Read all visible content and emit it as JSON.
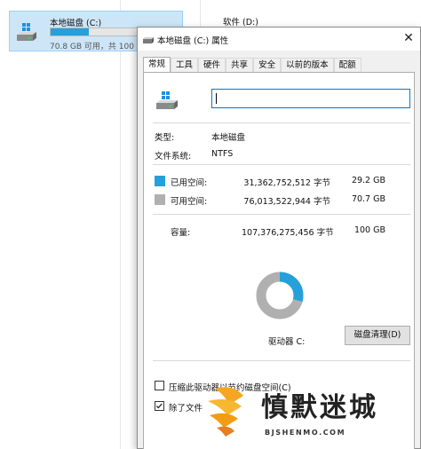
{
  "explorer": {
    "drive_c": {
      "name": "本地磁盘 (C:)",
      "free_text": "70.8 GB 可用，共 100 GB",
      "used_fraction": 0.29
    },
    "drive_d": {
      "name": "软件 (D:)"
    }
  },
  "dialog": {
    "title": "本地磁盘 (C:) 属性",
    "close_glyph": "✕",
    "tabs": [
      "常规",
      "工具",
      "硬件",
      "共享",
      "安全",
      "以前的版本",
      "配额"
    ],
    "active_tab": "常规",
    "label_value": "",
    "type_label": "类型:",
    "type_value": "本地磁盘",
    "fs_label": "文件系统:",
    "fs_value": "NTFS",
    "used": {
      "label": "已用空间:",
      "bytes": "31,362,752,512 字节",
      "size": "29.2 GB",
      "color": "#26a0da"
    },
    "free": {
      "label": "可用空间:",
      "bytes": "76,013,522,944 字节",
      "size": "70.7 GB",
      "color": "#b0b0b0"
    },
    "capacity": {
      "label": "容量:",
      "bytes": "107,376,275,456 字节",
      "size": "100 GB"
    },
    "drive_label": "驱动器 C:",
    "cleanup_button": "磁盘清理(D)",
    "compress_label": "压缩此驱动器以节约磁盘空间(C)",
    "index_label": "除了文件"
  },
  "watermark": {
    "text": "慎默迷城",
    "sub": "BJSHENMO.COM"
  }
}
